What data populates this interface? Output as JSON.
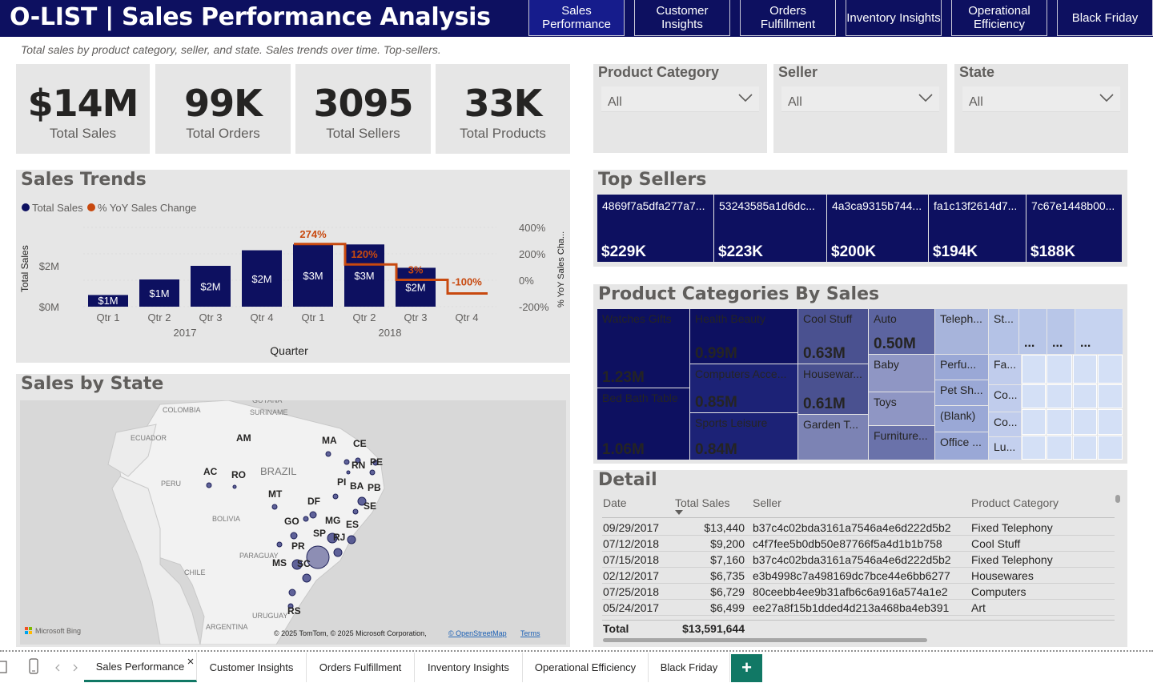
{
  "header": {
    "title": "O-LIST | Sales Performance Analysis",
    "subtitle": "Total sales by product category, seller, and state. Sales trends over time. Top-sellers.",
    "nav": [
      "Sales Performance",
      "Customer Insights",
      "Orders Fulfillment",
      "Inventory Insights",
      "Operational Efficiency",
      "Black Friday"
    ]
  },
  "kpis": [
    {
      "value": "$14M",
      "label": "Total Sales"
    },
    {
      "value": "99K",
      "label": "Total Orders"
    },
    {
      "value": "3095",
      "label": "Total Sellers"
    },
    {
      "value": "33K",
      "label": "Total Products"
    }
  ],
  "slicers": [
    {
      "title": "Product Category",
      "value": "All"
    },
    {
      "title": "Seller",
      "value": "All"
    },
    {
      "title": "State",
      "value": "All"
    }
  ],
  "sales_trends": {
    "title": "Sales Trends",
    "legend": [
      "Total Sales",
      "% YoY Sales Change"
    ],
    "colors": {
      "bars": "#0d1060",
      "line": "#c8490f"
    }
  },
  "chart_data": {
    "type": "bar",
    "categories": [
      "Qtr 1",
      "Qtr 2",
      "Qtr 3",
      "Qtr 4",
      "Qtr 1",
      "Qtr 2",
      "Qtr 3",
      "Qtr 4"
    ],
    "years": [
      "2017",
      "2018"
    ],
    "series": [
      {
        "name": "Total Sales",
        "values": [
          0.6,
          1.4,
          2.1,
          2.9,
          3.2,
          3.2,
          2.0,
          null
        ],
        "labels": [
          "$1M",
          "$1M",
          "$2M",
          "$2M",
          "$3M",
          "$3M",
          "$2M",
          ""
        ]
      },
      {
        "name": "% YoY Sales Change",
        "values": [
          null,
          null,
          null,
          null,
          274,
          120,
          3,
          -100
        ],
        "labels": [
          "",
          "",
          "",
          "",
          "274%",
          "120%",
          "3%",
          "-100%"
        ]
      }
    ],
    "xlabel": "Quarter",
    "ylabel": "Total Sales",
    "ylabel_right": "% YoY Sales Cha...",
    "y_ticks": [
      "$0M",
      "$2M"
    ],
    "y2_ticks": [
      "400%",
      "200%",
      "0%",
      "-200%"
    ],
    "ylim": [
      0,
      3.5
    ],
    "y2lim": [
      -200,
      400
    ]
  },
  "map": {
    "title": "Sales by State",
    "countries": [
      "GUYANA",
      "COLOMBIA",
      "SURINAME",
      "ECUADOR",
      "PERU",
      "BRAZIL",
      "BOLIVIA",
      "PARAGUAY",
      "CHILE",
      "URUGUAY",
      "ARGENTINA"
    ],
    "states": [
      "AM",
      "MA",
      "CE",
      "RN",
      "PE",
      "AC",
      "RO",
      "PI",
      "PB",
      "BA",
      "MT",
      "DF",
      "SE",
      "GO",
      "MG",
      "ES",
      "SP",
      "RJ",
      "PR",
      "MS",
      "SC",
      "RS"
    ],
    "attribution": "© 2025 TomTom, © 2025 Microsoft Corporation,",
    "osm": "© OpenStreetMap",
    "terms": "Terms",
    "bing": "Microsoft Bing"
  },
  "top_sellers": {
    "title": "Top Sellers",
    "items": [
      {
        "id": "4869f7a5dfa277a7...",
        "value": "$229K"
      },
      {
        "id": "53243585a1d6dc...",
        "value": "$223K"
      },
      {
        "id": "4a3ca9315b744...",
        "value": "$200K"
      },
      {
        "id": "fa1c13f2614d7...",
        "value": "$194K"
      },
      {
        "id": "7c67e1448b00...",
        "value": "$188K"
      }
    ]
  },
  "categories": {
    "title": "Product Categories By Sales",
    "items": [
      {
        "label": "Watches Gifts",
        "value": "1.23M"
      },
      {
        "label": "Bed Bath Table",
        "value": "1.06M"
      },
      {
        "label": "Health Beauty",
        "value": "0.99M"
      },
      {
        "label": "Computers Acce...",
        "value": "0.85M"
      },
      {
        "label": "Sports Leisure",
        "value": "0.84M"
      },
      {
        "label": "Cool Stuff",
        "value": "0.63M"
      },
      {
        "label": "Housewar...",
        "value": "0.61M"
      },
      {
        "label": "Garden T...",
        "value": ""
      },
      {
        "label": "Auto",
        "value": "0.50M"
      },
      {
        "label": "Baby",
        "value": ""
      },
      {
        "label": "Toys",
        "value": ""
      },
      {
        "label": "Furniture...",
        "value": ""
      },
      {
        "label": "Teleph...",
        "value": ""
      },
      {
        "label": "Perfu...",
        "value": ""
      },
      {
        "label": "Pet Sh...",
        "value": ""
      },
      {
        "label": "(Blank)",
        "value": ""
      },
      {
        "label": "Office ...",
        "value": ""
      },
      {
        "label": "St...",
        "value": ""
      },
      {
        "label": "Fa...",
        "value": ""
      },
      {
        "label": "Co...",
        "value": ""
      },
      {
        "label": "Co...",
        "value": ""
      },
      {
        "label": "Lu...",
        "value": ""
      },
      {
        "label": "...",
        "value": ""
      },
      {
        "label": "...",
        "value": ""
      },
      {
        "label": "...",
        "value": ""
      }
    ]
  },
  "detail": {
    "title": "Detail",
    "columns": [
      "Date",
      "Total Sales",
      "Seller",
      "Product Category"
    ],
    "rows": [
      [
        "09/29/2017",
        "$13,440",
        "b37c4c02bda3161a7546a4e6d222d5b2",
        "Fixed Telephony"
      ],
      [
        "07/12/2018",
        "$9,200",
        "c4f7fee5b0db50e87766f5a4d1b1b758",
        "Cool Stuff"
      ],
      [
        "07/15/2018",
        "$7,160",
        "b37c4c02bda3161a7546a4e6d222d5b2",
        "Fixed Telephony"
      ],
      [
        "02/12/2017",
        "$6,735",
        "e3b4998c7a498169dc7bce44e6bb6277",
        "Housewares"
      ],
      [
        "07/25/2018",
        "$6,729",
        "80ceebb4ee9b31afb6c6a916a574a1e2",
        "Computers"
      ],
      [
        "05/24/2017",
        "$6,499",
        "ee27a8f15b1dded4d213a468ba4eb391",
        "Art"
      ]
    ],
    "total_label": "Total",
    "total_value": "$13,591,644"
  },
  "tabs": [
    "Sales Performance",
    "Customer Insights",
    "Orders Fulfillment",
    "Inventory Insights",
    "Operational Efficiency",
    "Black Friday"
  ],
  "add_tab": "+"
}
